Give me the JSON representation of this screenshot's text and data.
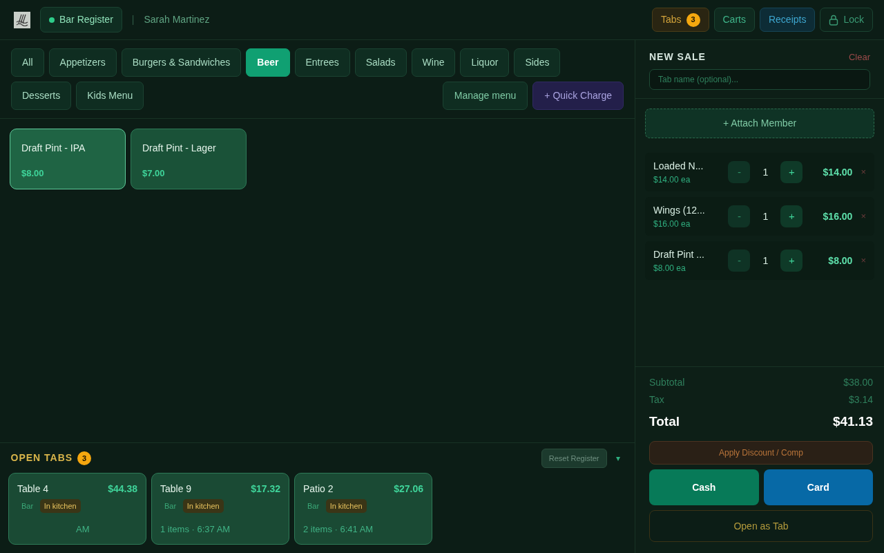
{
  "header": {
    "register": "Bar Register",
    "separator": "|",
    "user": "Sarah Martinez",
    "actions": [
      {
        "kind": "tabs",
        "label": "Tabs",
        "badge": "3"
      },
      {
        "kind": "carts",
        "label": "Carts"
      },
      {
        "kind": "receipts",
        "label": "Receipts"
      },
      {
        "kind": "lock",
        "label": "Lock"
      }
    ]
  },
  "categories": [
    {
      "label": "All",
      "selected": false
    },
    {
      "label": "Appetizers",
      "selected": false
    },
    {
      "label": "Burgers & Sandwiches",
      "selected": false
    },
    {
      "label": "Beer",
      "selected": true
    },
    {
      "label": "Entrees",
      "selected": false
    },
    {
      "label": "Salads",
      "selected": false
    },
    {
      "label": "Wine",
      "selected": false
    },
    {
      "label": "Liquor",
      "selected": false
    },
    {
      "label": "Sides",
      "selected": false
    },
    {
      "label": "Desserts",
      "selected": false
    },
    {
      "label": "Kids Menu",
      "selected": false
    }
  ],
  "menu_actions": [
    {
      "kind": "manage",
      "label": "Manage menu"
    },
    {
      "kind": "quick",
      "label": "+ Quick Charge"
    }
  ],
  "products": [
    {
      "name": "Draft Pint - IPA",
      "price": "$8.00",
      "selected": true
    },
    {
      "name": "Draft Pint - Lager",
      "price": "$7.00",
      "selected": false
    }
  ],
  "open_tabs": {
    "title": "OPEN TABS",
    "count": "3",
    "toggle": "▾",
    "tabs": [
      {
        "name": "Table 4",
        "total": "$44.38",
        "tags": [
          "Bar",
          "In kitchen"
        ],
        "meta": "AM"
      },
      {
        "name": "Table 9",
        "total": "$17.32",
        "tags": [
          "Bar",
          "In kitchen"
        ],
        "meta": "1 items · 6:37 AM"
      },
      {
        "name": "Patio 2",
        "total": "$27.06",
        "tags": [
          "Bar",
          "In kitchen"
        ],
        "meta": "2 items · 6:41 AM"
      }
    ]
  },
  "reset_button": "Reset Register",
  "sale": {
    "title": "NEW SALE",
    "clear": "Clear",
    "tab_name": {
      "placeholder": "Tab name (optional)..."
    },
    "attach": "+ Attach Member",
    "items": [
      {
        "name": "Loaded N...",
        "unit": "$14.00 ea",
        "qty": "1",
        "total": "$14.00",
        "minus": "-",
        "plus": "+",
        "remove": "×"
      },
      {
        "name": "Wings (12...",
        "unit": "$16.00 ea",
        "qty": "1",
        "total": "$16.00",
        "minus": "-",
        "plus": "+",
        "remove": "×"
      },
      {
        "name": "Draft Pint ...",
        "unit": "$8.00 ea",
        "qty": "1",
        "total": "$8.00",
        "minus": "-",
        "plus": "+",
        "remove": "×"
      }
    ],
    "subtotal": {
      "label": "Subtotal",
      "value": "$38.00"
    },
    "tax": {
      "label": "Tax",
      "value": "$3.14"
    },
    "total": {
      "label": "Total",
      "value": "$41.13"
    },
    "discount": "Apply Discount / Comp",
    "pay": [
      {
        "kind": "cash",
        "label": "Cash"
      },
      {
        "kind": "card",
        "label": "Card"
      }
    ],
    "open_tab": "Open as Tab"
  }
}
